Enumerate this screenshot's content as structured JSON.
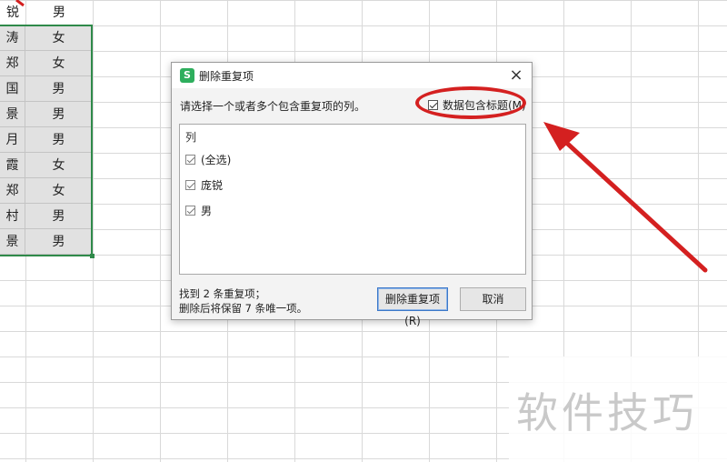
{
  "sheet": {
    "header_row": [
      "锐",
      "男"
    ],
    "rows": [
      [
        "涛",
        "女"
      ],
      [
        "郑",
        "女"
      ],
      [
        "国",
        "男"
      ],
      [
        "景",
        "男"
      ],
      [
        "月",
        "男"
      ],
      [
        "霞",
        "女"
      ],
      [
        "郑",
        "女"
      ],
      [
        "村",
        "男"
      ],
      [
        "景",
        "男"
      ]
    ]
  },
  "dialog": {
    "title": "删除重复项",
    "app_logo": "S",
    "close_label": "×",
    "instruction": "请选择一个或者多个包含重复项的列。",
    "header_checkbox_label": "数据包含标题(M)",
    "list_header": "列",
    "columns": [
      {
        "label": "(全选)",
        "checked": true
      },
      {
        "label": "庞锐",
        "checked": true
      },
      {
        "label": "男",
        "checked": true
      }
    ],
    "footer_line1": "找到 2 条重复项；",
    "footer_line2": "删除后将保留 7 条唯一项。",
    "remove_button": "删除重复项(R)",
    "cancel_button": "取消"
  },
  "watermark": "软件技巧",
  "colors": {
    "annotation": "#d42020",
    "selection": "#2f8a4a",
    "app_logo": "#2eae5d"
  }
}
